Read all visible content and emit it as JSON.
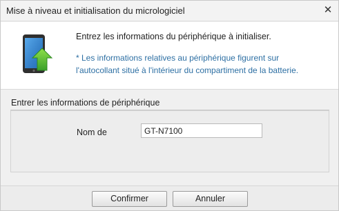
{
  "window": {
    "title": "Mise à niveau et initialisation du micrologiciel",
    "close_glyph": "✕"
  },
  "header": {
    "icon": "phone-upload-icon",
    "message": "Entrez les informations du périphérique à initialiser.",
    "note": "* Les informations relatives au périphérique figurent sur l'autocollant situé à l'intérieur du compartiment de la batterie.",
    "note_color": "#2d6fa3"
  },
  "device_info": {
    "section_label": "Entrer les informations de périphérique",
    "model_label": "Nom de",
    "model_value": "GT-N7100"
  },
  "buttons": {
    "confirm_label": "Confirmer",
    "cancel_label": "Annuler"
  }
}
